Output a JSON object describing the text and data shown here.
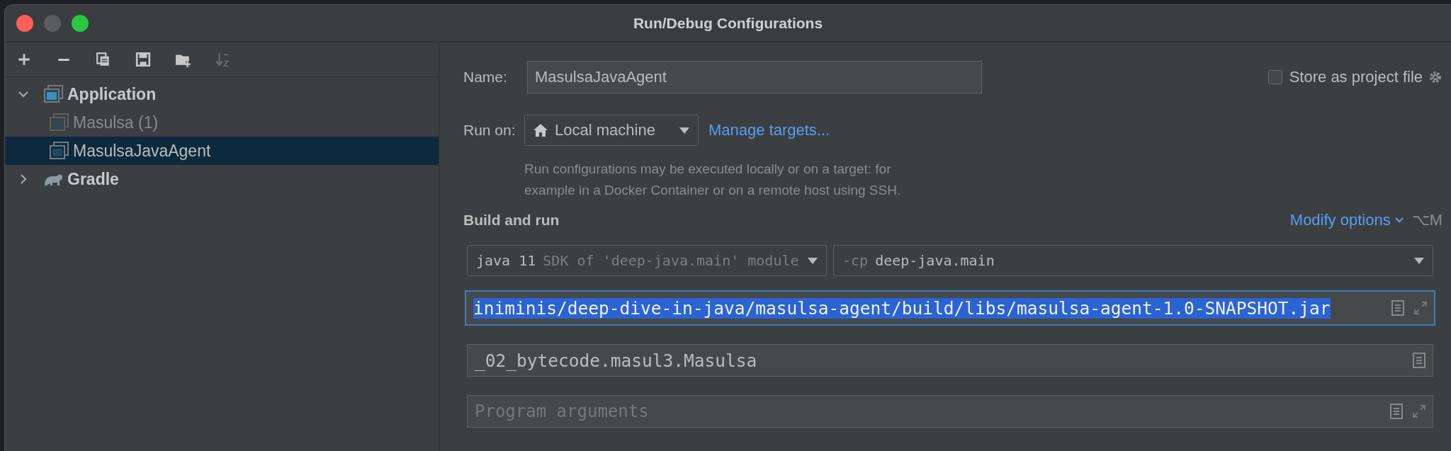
{
  "window": {
    "title": "Run/Debug Configurations"
  },
  "toolbar": [
    {
      "kind": "add",
      "disabled": false
    },
    {
      "kind": "remove",
      "disabled": false
    },
    {
      "kind": "copy",
      "disabled": false
    },
    {
      "kind": "save",
      "disabled": false
    },
    {
      "kind": "folder",
      "disabled": false
    },
    {
      "kind": "sort",
      "disabled": true
    }
  ],
  "tree": [
    {
      "label": "Application",
      "kind": "application",
      "expanded": true,
      "selected": false,
      "children": [
        {
          "label": "Masulsa (1)",
          "temporary": true,
          "selected": false
        },
        {
          "label": "MasulsaJavaAgent",
          "temporary": false,
          "selected": true
        }
      ]
    },
    {
      "label": "Gradle",
      "kind": "gradle",
      "expanded": false,
      "selected": false
    }
  ],
  "name": {
    "label": "Name:",
    "value": "MasulsaJavaAgent"
  },
  "store_as_project_file": {
    "label": "Store as project file",
    "checked": false
  },
  "run_on": {
    "label": "Run on:",
    "value": "Local machine",
    "link": "Manage targets..."
  },
  "run_on_help": "Run configurations may be executed locally or on a target: for\nexample in a Docker Container or on a remote host using SSH.",
  "build_and_run": {
    "title": "Build and run",
    "modify_options": "Modify options",
    "shortcut": "⌥M",
    "jdk": {
      "value": "java 11",
      "hint": "SDK of 'deep-java.main' module"
    },
    "classpath": {
      "prefix": "-cp",
      "value": "deep-java.main"
    },
    "vm_options": {
      "value": "iniminis/deep-dive-in-java/masulsa-agent/build/libs/masulsa-agent-1.0-SNAPSHOT.jar",
      "focused": true,
      "text_selected": true
    },
    "main_class": {
      "value": "_02_bytecode.masul3.Masulsa"
    },
    "program_arguments": {
      "placeholder": "Program arguments"
    }
  }
}
